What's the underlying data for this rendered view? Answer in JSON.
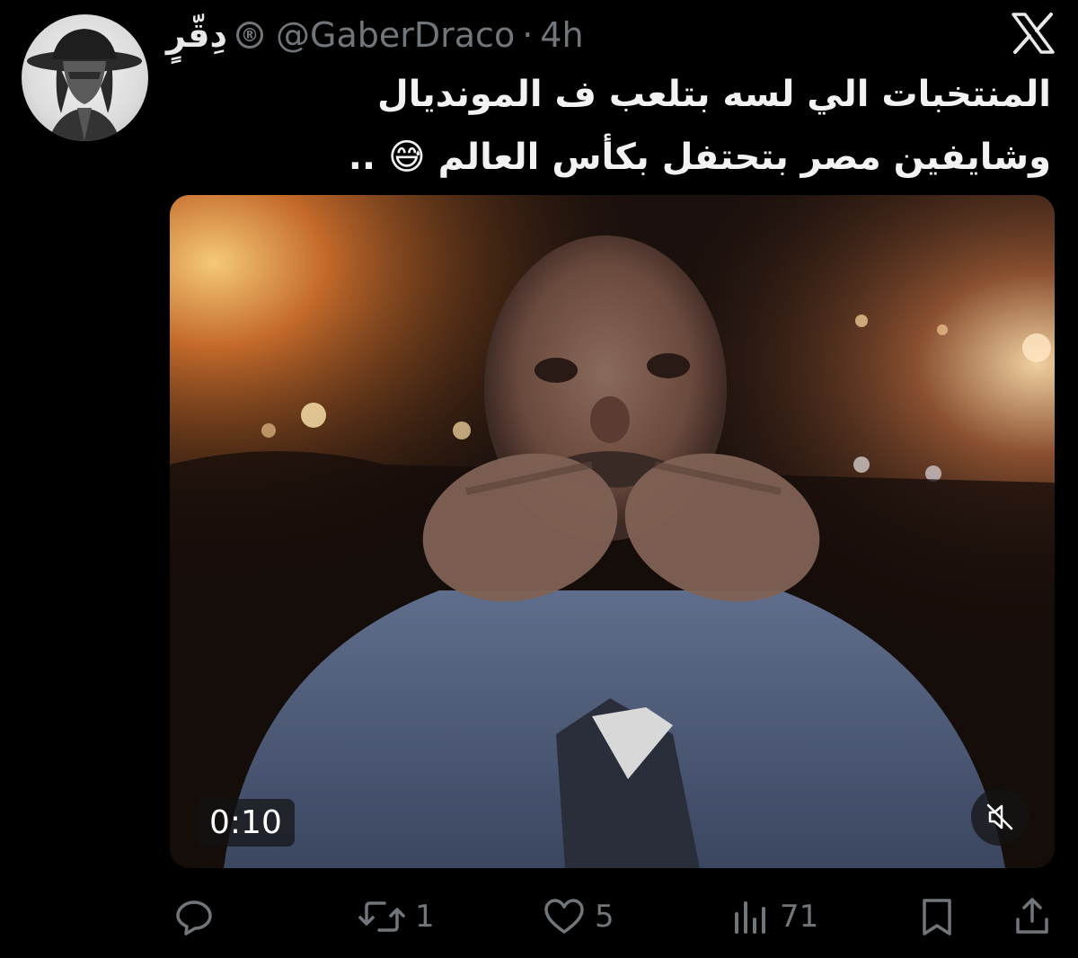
{
  "tweet": {
    "author": {
      "display_name": "دِقّرٍ",
      "badge": "®",
      "handle": "@GaberDraco",
      "separator": "·",
      "time": "4h"
    },
    "text_lines": [
      "المنتخبات الي لسه بتلعب ف المونديال",
      "وشايفين مصر بتحتفل بكأس العالم 😅 .."
    ],
    "media": {
      "duration": "0:10",
      "mute_icon": "speaker-muted-icon"
    },
    "actions": {
      "reply_count": "",
      "retweet_count": "1",
      "like_count": "5",
      "views_count": "71"
    }
  },
  "colors": {
    "background": "#000000",
    "text": "#e7e9ea",
    "secondary": "#71767b"
  }
}
